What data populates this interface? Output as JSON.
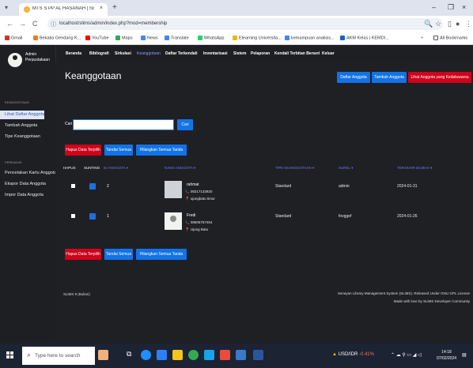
{
  "browser": {
    "tab_title": "MTS S PP AL HASANAH | Sister",
    "url": "localhost/slims/admin/index.php?mod=membership",
    "new_tab": "+",
    "tab_close": "×",
    "win_min": "–",
    "win_max": "ð",
    "win_close": "×",
    "back": "←",
    "forward": "→",
    "reload": "C",
    "bookmarks": [
      {
        "label": "Gmail",
        "color": "#d93025"
      },
      {
        "label": "Bekatia Gendang K...",
        "color": "#e67e22"
      },
      {
        "label": "YouTube",
        "color": "#ff0000"
      },
      {
        "label": "Maps",
        "color": "#34a853"
      },
      {
        "label": "News",
        "color": "#4285f4"
      },
      {
        "label": "Translate",
        "color": "#4285f4"
      },
      {
        "label": "WhatsApp",
        "color": "#25d366"
      },
      {
        "label": "Elearning Universita...",
        "color": "#f4b400"
      },
      {
        "label": "kemampuan analisis...",
        "color": "#4285f4"
      },
      {
        "label": "AKM Kelas | KEMDI...",
        "color": "#1565c0"
      }
    ],
    "bookmarks_more": "»",
    "all_bookmarks": "All Bookmarks"
  },
  "sidebar": {
    "user_name": "Admin Perpustakaan",
    "section_keanggotaan": "KEANGGOTAAN",
    "items_top": [
      {
        "label": "Lihat Daftar Anggota",
        "active": true
      },
      {
        "label": "Tambah Anggota",
        "active": false
      },
      {
        "label": "Tipe Keanggotaan",
        "active": false
      }
    ],
    "section_perkakas": "PERKAKAS",
    "items_tools": [
      {
        "label": "Pencetakan Kartu Anggota"
      },
      {
        "label": "Ekspor Data Anggota"
      },
      {
        "label": "Impor Data Anggota"
      }
    ]
  },
  "topnav": {
    "items": [
      "Beranda",
      "Bibliografi",
      "Sirkulasi",
      "Keanggotaan",
      "Daftar Terkendali",
      "Inventarisasi",
      "Sistem",
      "Pelaporan",
      "Kendali Terbitan Berseri",
      "Keluar"
    ],
    "active_index": 3
  },
  "main": {
    "title": "Keanggotaan",
    "btn_daftar": "Daftar Anggota",
    "btn_tambah": "Tambah Anggota",
    "btn_kedaluwarsa": "Lihat Anggota yang Kedaluwarsa",
    "search_label": "Cari",
    "search_value": "",
    "search_button": "Cari",
    "btn_hapus": "Hapus Data Terpilih",
    "btn_tandai": "Tandai Semua",
    "btn_hilangkan": "Hilangkan Semua Tanda",
    "columns": [
      "HAPUS",
      "SUNTING",
      "ID ANGGOTA ▾",
      "NAMA ANGGOTA ▾",
      "TIPE KEANGGOTAAN ▾",
      "SUREL ▾",
      "TERAKHIR DIUBAH ▾"
    ],
    "rows": [
      {
        "id": "2",
        "name": "rahmat",
        "phone": "📞 08217133920",
        "address": "📍 ujungbatu timur",
        "type": "Standard",
        "email": "admin",
        "date": "2024-01-31"
      },
      {
        "id": "1",
        "name": "Fredi",
        "phone": "📞 08606757454",
        "address": "📍 Ujung Batu",
        "type": "Standard",
        "email": "fovggef",
        "date": "2024-01-26"
      }
    ],
    "footer_left": "SLiMS 9 (Bulian)",
    "footer_right_1": "Senayan Library Management System (SLiMS). Released Under GNU GPL License",
    "footer_right_2": "Made with love by SLiMS Developer Community"
  },
  "taskbar": {
    "search_placeholder": "Type here to search",
    "currency": "USD/IDR",
    "currency_change": "-0.41%",
    "time": "14:18",
    "date": "07/02/2024"
  }
}
